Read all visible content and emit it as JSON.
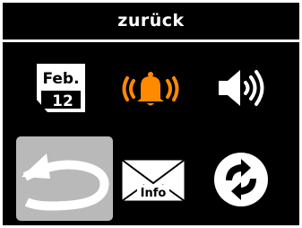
{
  "header": {
    "title": "zurück"
  },
  "menu": {
    "calendar": {
      "month": "Feb.",
      "day": "12",
      "icon": "calendar-icon"
    },
    "alarm": {
      "icon": "bell-alarm-icon",
      "color": "#ff8a00"
    },
    "volume": {
      "icon": "speaker-volume-icon"
    },
    "back": {
      "icon": "back-arrow-icon",
      "selected": true
    },
    "info": {
      "text": "Info",
      "icon": "envelope-info-icon"
    },
    "sync": {
      "icon": "sync-icon"
    }
  },
  "colors": {
    "background": "#000000",
    "foreground": "#ffffff",
    "selection": "#b9b9b9",
    "accent": "#ff8a00"
  }
}
